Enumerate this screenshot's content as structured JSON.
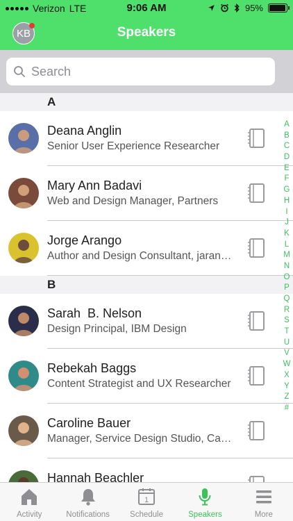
{
  "status_bar": {
    "carrier": "Verizon",
    "network": "LTE",
    "time": "9:06 AM",
    "battery": "95%",
    "battery_level": 0.95
  },
  "nav": {
    "title": "Speakers",
    "avatar_initials": "KB"
  },
  "search": {
    "placeholder": "Search"
  },
  "sections": [
    {
      "letter": "A",
      "speakers": [
        {
          "name": "Deana Anglin",
          "title": "Senior User Experience Researcher"
        },
        {
          "name": "Mary Ann Badavi",
          "title": "Web and Design Manager, Partners"
        },
        {
          "name": "Jorge Arango",
          "title": "Author and Design Consultant, jarango.com"
        }
      ]
    },
    {
      "letter": "B",
      "speakers": [
        {
          "name": "Sarah  B. Nelson",
          "title": "Design Principal, IBM Design"
        },
        {
          "name": "Rebekah Baggs",
          "title": "Content Strategist and UX Researcher"
        },
        {
          "name": "Caroline Bauer",
          "title": "Manager, Service Design Studio, Capital One"
        },
        {
          "name": "Hannah Beachler",
          "title": ""
        }
      ]
    }
  ],
  "index_letters": [
    "A",
    "B",
    "C",
    "D",
    "E",
    "F",
    "G",
    "H",
    "I",
    "J",
    "K",
    "L",
    "M",
    "N",
    "O",
    "P",
    "Q",
    "R",
    "S",
    "T",
    "U",
    "V",
    "W",
    "X",
    "Y",
    "Z",
    "#"
  ],
  "tabs": [
    {
      "label": "Activity",
      "icon": "home-icon"
    },
    {
      "label": "Notifications",
      "icon": "bell-icon"
    },
    {
      "label": "Schedule",
      "icon": "calendar-icon",
      "calendar_day": "1"
    },
    {
      "label": "Speakers",
      "icon": "microphone-icon",
      "active": true
    },
    {
      "label": "More",
      "icon": "menu-icon"
    }
  ],
  "colors": {
    "brand_green": "#4ee06b",
    "accent_green": "#3cc25b",
    "inactive_gray": "#8e8e93"
  }
}
